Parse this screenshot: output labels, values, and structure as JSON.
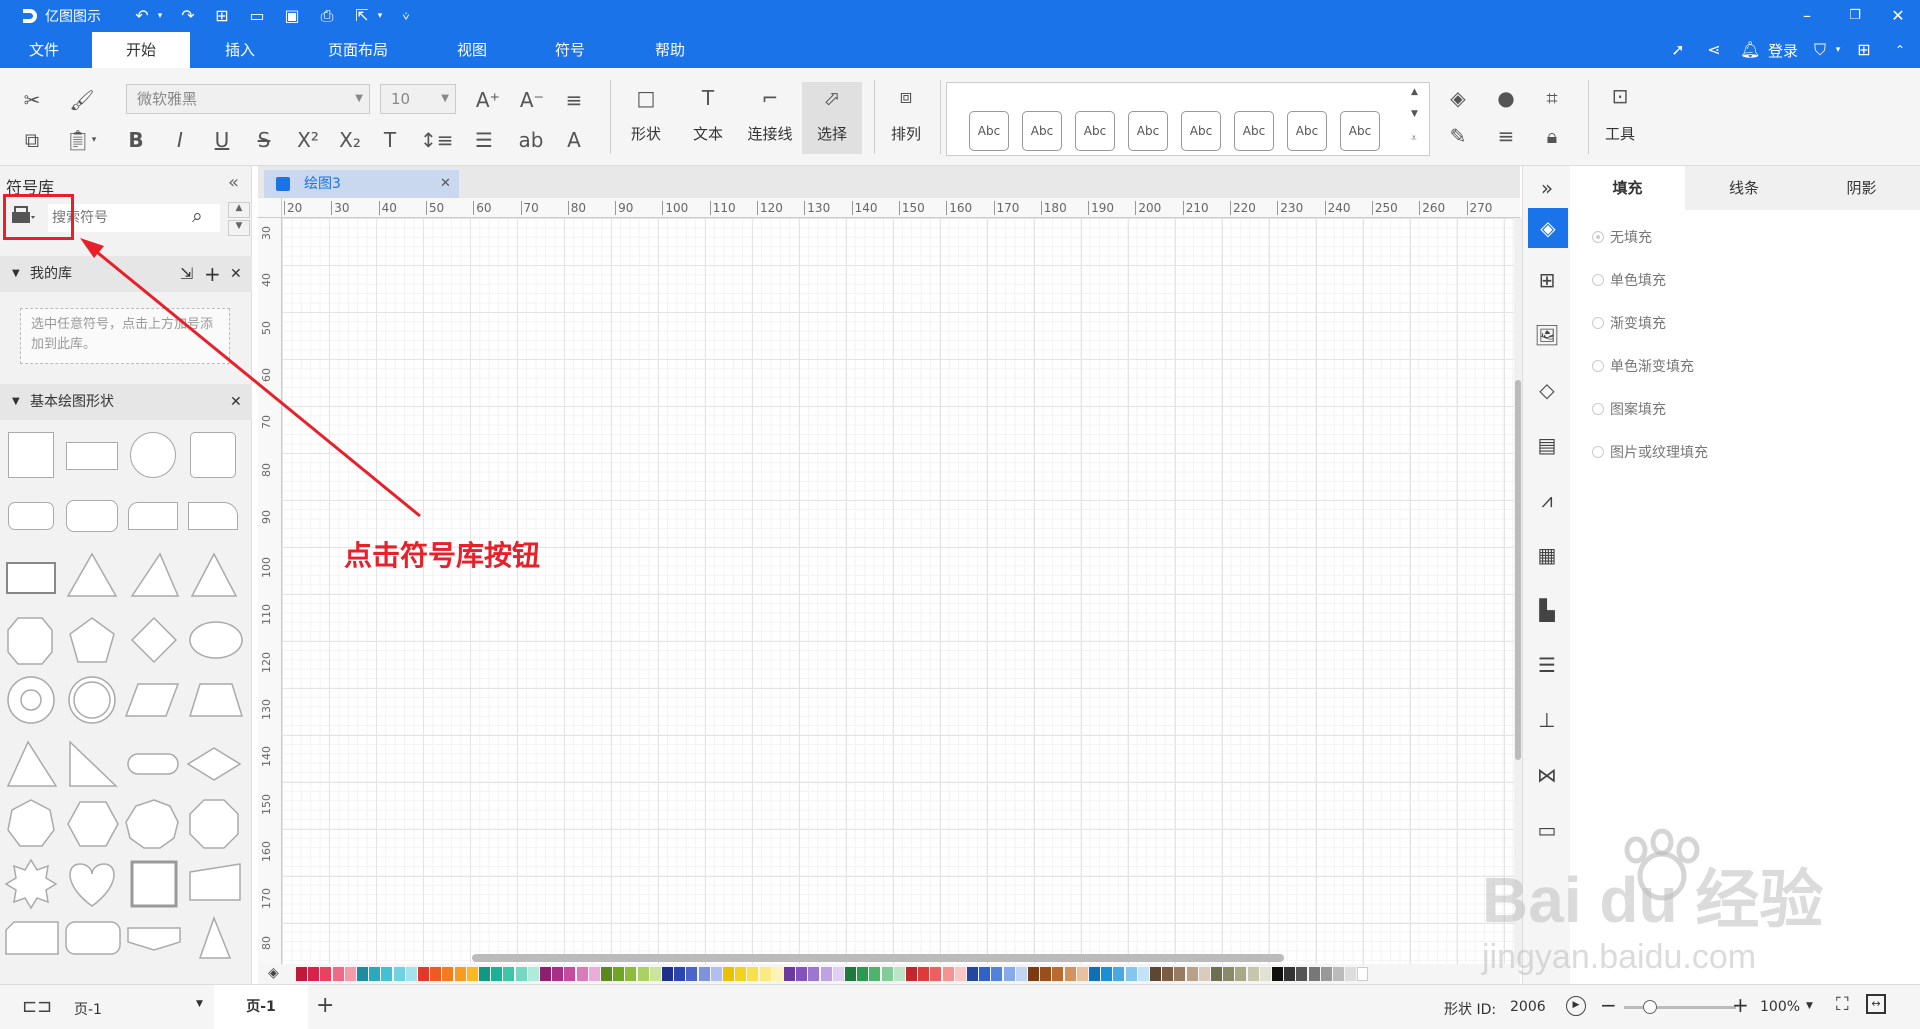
{
  "app": {
    "title": "亿图图示",
    "login_label": "登录"
  },
  "menu": {
    "tabs": [
      "文件",
      "开始",
      "插入",
      "页面布局",
      "视图",
      "符号",
      "帮助"
    ]
  },
  "ribbon": {
    "font_name": "微软雅黑",
    "font_size": "10",
    "tools": [
      "形状",
      "文本",
      "连接线",
      "选择"
    ],
    "arrange_label": "排列",
    "tools_label": "工具",
    "style_samples": [
      "Abc",
      "Abc",
      "Abc",
      "Abc",
      "Abc",
      "Abc",
      "Abc",
      "Abc"
    ]
  },
  "left_panel": {
    "title": "符号库",
    "search_placeholder": "搜索符号",
    "my_library": {
      "title": "我的库",
      "hint": "选中任意符号，点击上方加号添加到此库。"
    },
    "basic_shapes": {
      "title": "基本绘图形状"
    }
  },
  "document": {
    "tab_label": "绘图3",
    "hruler_ticks": [
      "20",
      "30",
      "40",
      "50",
      "60",
      "70",
      "80",
      "90",
      "100",
      "110",
      "120",
      "130",
      "140",
      "150",
      "160",
      "170",
      "180",
      "190",
      "200",
      "210",
      "220",
      "230",
      "240",
      "250",
      "260",
      "270"
    ],
    "vruler_ticks": [
      "30",
      "40",
      "50",
      "60",
      "70",
      "80",
      "90",
      "100",
      "110",
      "120",
      "130",
      "140",
      "150",
      "160",
      "170",
      "80"
    ]
  },
  "right_panel": {
    "tabs": [
      "填充",
      "线条",
      "阴影"
    ],
    "fill_options": [
      "无填充",
      "单色填充",
      "渐变填充",
      "单色渐变填充",
      "图案填充",
      "图片或纹理填充"
    ]
  },
  "status": {
    "page_selector": "页-1",
    "page_tab": "页-1",
    "shape_id_label": "形状 ID:",
    "shape_id": "2006",
    "zoom": "100%"
  },
  "annotation": {
    "text": "点击符号库按钮"
  },
  "watermark": {
    "line1": "Bai du 经验",
    "line2": "jingyan.baidu.com"
  },
  "colors": {
    "brand": "#1a73e8",
    "annotation": "#e8202a"
  },
  "palette_colors": [
    "#c0183c",
    "#d9214a",
    "#e8435e",
    "#ef6a82",
    "#f59aac",
    "#1c8ca0",
    "#2aa8bd",
    "#43c0d2",
    "#6fd2e0",
    "#a5e3ec",
    "#e0392a",
    "#ee5a22",
    "#f57b1f",
    "#f99b20",
    "#fbb821",
    "#109980",
    "#18b394",
    "#3dc7a8",
    "#76d9bf",
    "#b0ebda",
    "#8e1f6f",
    "#a92e86",
    "#c44c9f",
    "#d97bbb",
    "#eaaed6",
    "#5a8a1e",
    "#6fa424",
    "#8cbc3a",
    "#aad066",
    "#cbe49c",
    "#1f2f8e",
    "#2a44b0",
    "#4a64cc",
    "#7e93de",
    "#b1bfee",
    "#e8c200",
    "#f2d21b",
    "#f8e04a",
    "#fbea82",
    "#fdf3b8",
    "#6a3aa0",
    "#8252bd",
    "#9d76d0",
    "#bea2e1",
    "#ddd0f0",
    "#1e7a3c",
    "#2a9a4e",
    "#4db46c",
    "#83cc98",
    "#bce4c6",
    "#c2272d",
    "#dd3a3a",
    "#ee6060",
    "#f59292",
    "#fac6c6",
    "#23479e",
    "#2f62c4",
    "#4f83dc",
    "#87abea",
    "#c0d5f5",
    "#7a3b12",
    "#9a4e1a",
    "#b86a30",
    "#d3935e",
    "#e8c1a0",
    "#0f70b8",
    "#1a8fd6",
    "#4aa9e2",
    "#86c6ec",
    "#c2e2f6",
    "#5e4632",
    "#7a5d44",
    "#987c62",
    "#b9a08a",
    "#dacbbd",
    "#6e6e50",
    "#8a8a66",
    "#a8a886",
    "#c6c6ac",
    "#e2e2d4",
    "#101010",
    "#333333",
    "#555555",
    "#777777",
    "#999999",
    "#bbbbbb",
    "#dddddd",
    "#ffffff"
  ]
}
